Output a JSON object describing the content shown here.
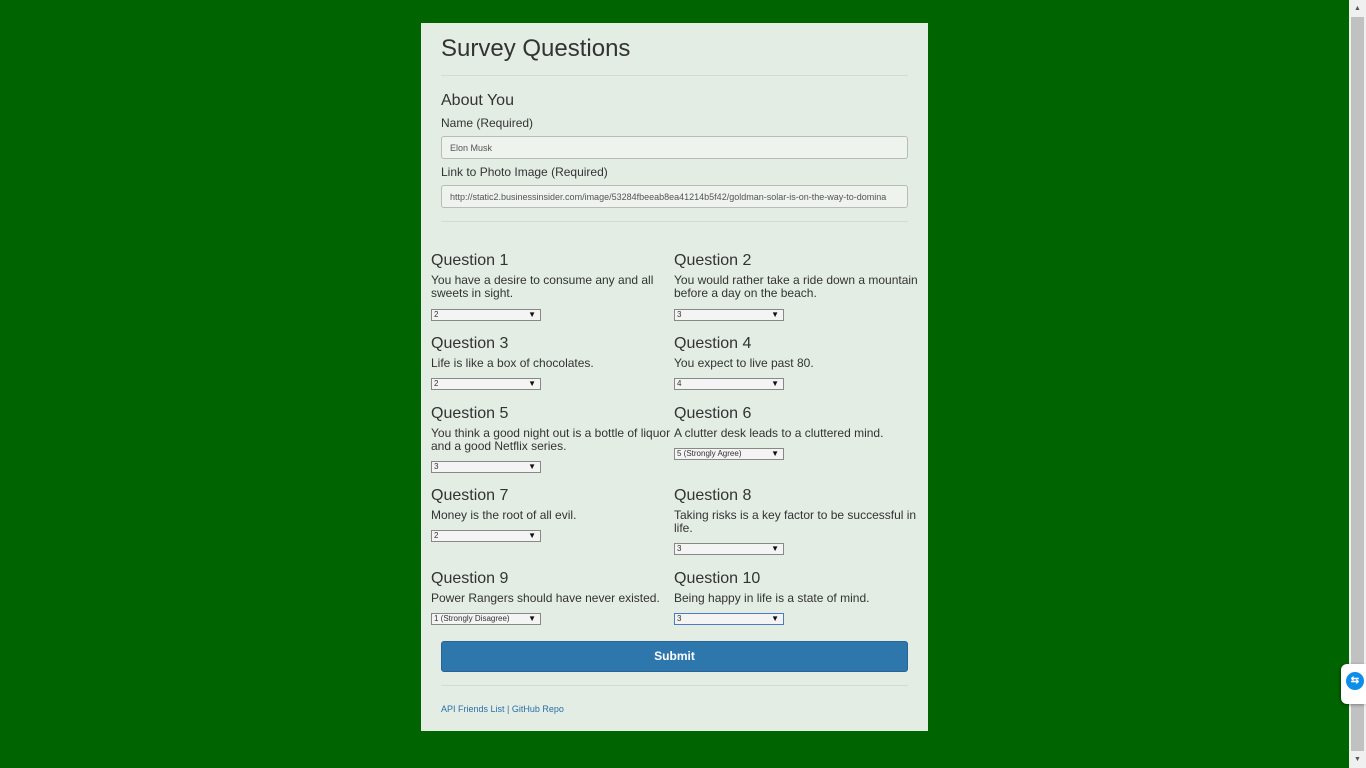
{
  "page": {
    "title": "Survey Questions"
  },
  "about": {
    "title": "About You",
    "name_label": "Name (Required)",
    "name_value": "Elon Musk",
    "photo_label": "Link to Photo Image (Required)",
    "photo_value": "http://static2.businessinsider.com/image/53284fbeeab8ea41214b5f42/goldman-solar-is-on-the-way-to-domina"
  },
  "questions": [
    {
      "title": "Question 1",
      "text": "You have a desire to consume any and all sweets in sight.",
      "selected": "2"
    },
    {
      "title": "Question 2",
      "text": "You would rather take a ride down a mountain before a day on the beach.",
      "selected": "3"
    },
    {
      "title": "Question 3",
      "text": "Life is like a box of chocolates.",
      "selected": "2"
    },
    {
      "title": "Question 4",
      "text": "You expect to live past 80.",
      "selected": "4"
    },
    {
      "title": "Question 5",
      "text": "You think a good night out is a bottle of liquor and a good Netflix series.",
      "selected": "3"
    },
    {
      "title": "Question 6",
      "text": "A clutter desk leads to a cluttered mind.",
      "selected": "5 (Strongly Agree)"
    },
    {
      "title": "Question 7",
      "text": "Money is the root of all evil.",
      "selected": "2"
    },
    {
      "title": "Question 8",
      "text": "Taking risks is a key factor to be successful in life.",
      "selected": "3"
    },
    {
      "title": "Question 9",
      "text": "Power Rangers should have never existed.",
      "selected": "1 (Strongly Disagree)"
    },
    {
      "title": "Question 10",
      "text": "Being happy in life is a state of mind.",
      "selected": "3"
    }
  ],
  "submit_label": "Submit",
  "footer": {
    "link1": "API Friends List",
    "separator": "|",
    "link2": "GitHub Repo"
  },
  "colors": {
    "background": "#006400",
    "panel": "#e3ede3",
    "button": "#2e77ad",
    "link": "#2a6fab"
  },
  "icons": {
    "dropdown": "chevron-down-icon",
    "teamviewer": "teamviewer-icon"
  }
}
